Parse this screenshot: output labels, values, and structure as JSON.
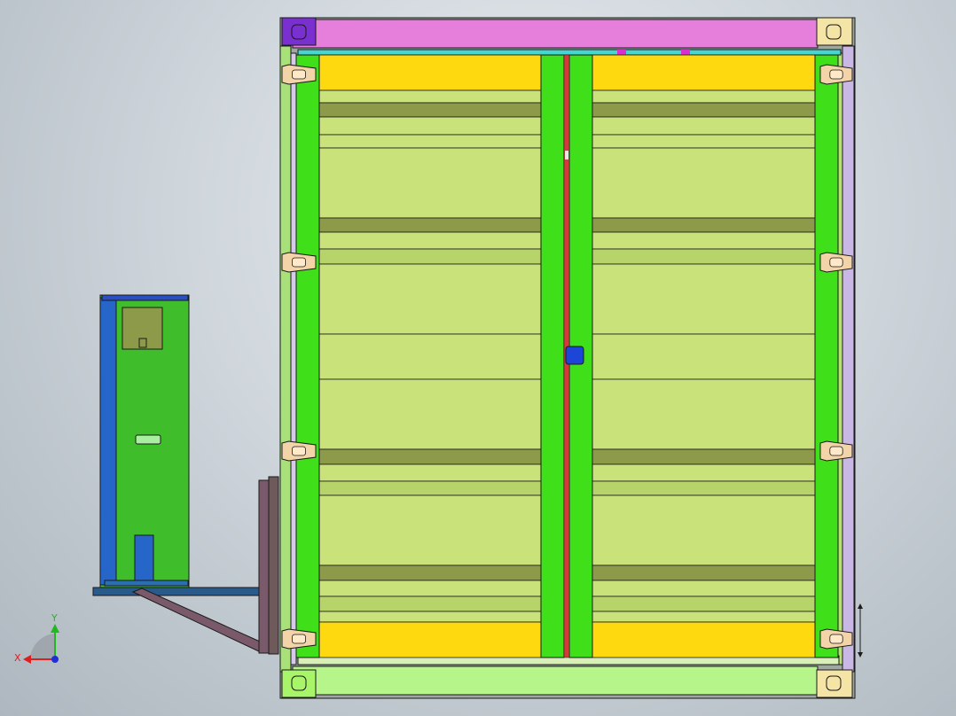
{
  "viewport": {
    "background_colors": [
      "#e8ecef",
      "#cfd6dc",
      "#aeb7bf"
    ]
  },
  "triad": {
    "x_label": "X",
    "y_label": "Y",
    "x_color": "#e01e1e",
    "y_color": "#1fb81f",
    "z_color": "#1e2fd8"
  },
  "colors": {
    "top_beam": "#e57fdb",
    "bottom_beam": "#b6f58a",
    "corner_purple": "#7a2fd0",
    "corner_cream": "#f4e4a6",
    "frame_post": "#8ed85a",
    "door_bar": "#3fe01a",
    "panel_light": "#c9e27a",
    "panel_dark": "#8d9a4a",
    "panel_yellow": "#ffd910",
    "hinge": "#f3d3a8",
    "side_unit_green": "#3fbd2a",
    "side_unit_blue": "#2566c8",
    "bracket_brown": "#7a5a6a",
    "seal_red": "#d43a3a",
    "latch_blue": "#1d45d8"
  }
}
